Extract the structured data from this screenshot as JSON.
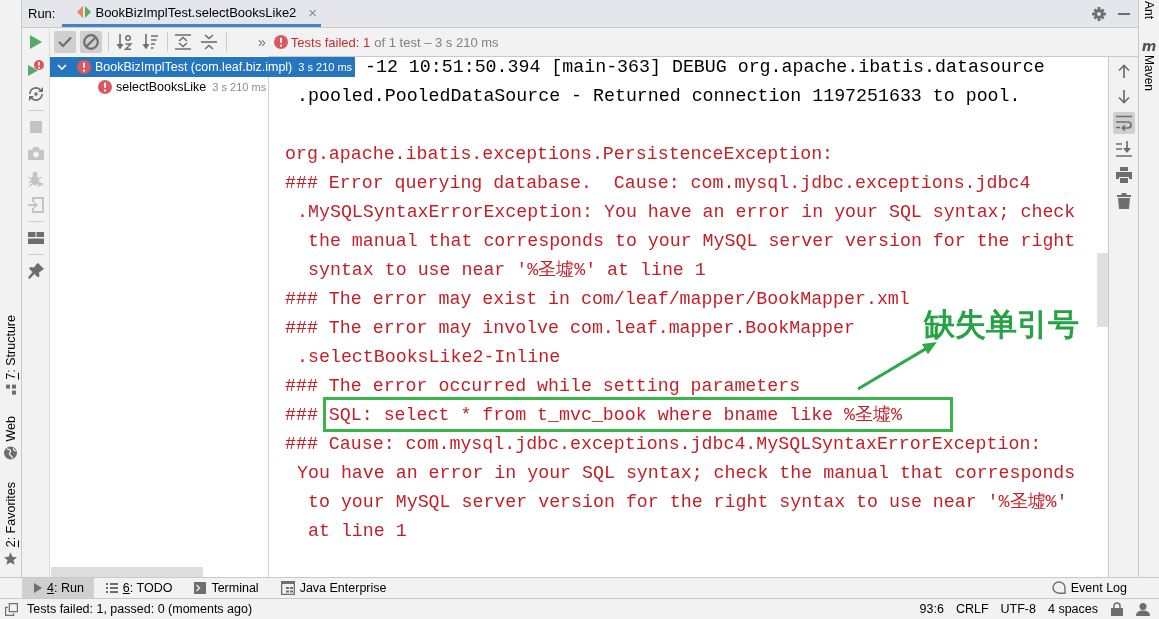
{
  "run_panel": {
    "title": "Run:",
    "tabs": [
      {
        "label": "BookBizImplTest.selectBooksLike2",
        "close": "×",
        "selected": true
      }
    ]
  },
  "run_toolbar": [
    [
      {
        "kind": "play",
        "disabled": false
      },
      {
        "kind": "play-error",
        "disabled": false
      },
      {
        "kind": "cycle",
        "disabled": false
      }
    ],
    [
      {
        "kind": "stop",
        "disabled": true
      },
      {
        "kind": "camera",
        "disabled": true
      },
      {
        "kind": "bug",
        "disabled": true
      },
      {
        "kind": "exit",
        "disabled": true
      }
    ],
    [
      {
        "kind": "layout",
        "disabled": false
      }
    ],
    [
      {
        "kind": "pin",
        "disabled": false
      }
    ]
  ],
  "test_toolbar": {
    "groups": [
      [
        {
          "kind": "check",
          "on": true
        },
        {
          "kind": "ban",
          "on": true
        }
      ],
      [
        {
          "kind": "sort-az",
          "on": false
        },
        {
          "kind": "sort-lines",
          "on": false
        }
      ],
      [
        {
          "kind": "expand",
          "on": false
        },
        {
          "kind": "collapse",
          "on": false
        }
      ]
    ],
    "more": "»",
    "summary": {
      "failed": true,
      "label": "Tests failed: 1",
      "detail": "of 1 test – 3 s 210 ms"
    }
  },
  "test_tree": [
    {
      "name": "BookBizImplTest (com.leaf.biz.impl)",
      "duration": "3 s 210 ms",
      "failed": true,
      "selected": true,
      "expanded": true,
      "children": [
        {
          "name": "selectBooksLike",
          "duration": "3 s 210 ms",
          "failed": true,
          "selected": false
        }
      ]
    }
  ],
  "console": {
    "messages": [
      {
        "kind": "debug",
        "covered": true,
        "highlighted": false,
        "lines": [
          "-12 10:51:50.394 [main-363] DEBUG org.apache.ibatis.datasource",
          ".pooled.PooledDataSource - Returned connection 1197251633 to pool."
        ]
      },
      {
        "kind": "blank"
      },
      {
        "kind": "error",
        "covered": false,
        "highlighted": false,
        "lines": [
          "org.apache.ibatis.exceptions.PersistenceException:"
        ]
      },
      {
        "kind": "error",
        "covered": false,
        "highlighted": false,
        "lines": [
          "### Error querying database.  Cause: com.mysql.jdbc.exceptions.jdbc4",
          ".MySQLSyntaxErrorException: You have an error in your SQL syntax; check",
          "the manual that corresponds to your MySQL server version for the right",
          "syntax to use near '%圣墟%' at line 1"
        ]
      },
      {
        "kind": "error",
        "covered": false,
        "highlighted": false,
        "lines": [
          "### The error may exist in com/leaf/mapper/BookMapper.xml"
        ]
      },
      {
        "kind": "error",
        "covered": false,
        "highlighted": false,
        "lines": [
          "### The error may involve com.leaf.mapper.BookMapper",
          ".selectBooksLike2-Inline"
        ]
      },
      {
        "kind": "error",
        "covered": false,
        "highlighted": false,
        "lines": [
          "### The error occurred while setting parameters"
        ]
      },
      {
        "kind": "error",
        "covered": false,
        "highlighted": true,
        "note": "缺失单引号",
        "lines": [
          "### SQL: select * from t_mvc_book where bname like %圣墟%"
        ]
      },
      {
        "kind": "error",
        "covered": false,
        "highlighted": false,
        "lines": [
          "### Cause: com.mysql.jdbc.exceptions.jdbc4.MySQLSyntaxErrorException:",
          "You have an error in your SQL syntax; check the manual that corresponds",
          "to your MySQL server version for the right syntax to use near '%圣墟%'",
          "at line 1"
        ]
      }
    ]
  },
  "console_toolbar": [
    {
      "kind": "up",
      "on": false
    },
    {
      "kind": "down",
      "on": false
    },
    {
      "kind": "wrap",
      "on": true
    },
    {
      "kind": "scroll-end",
      "on": false
    },
    {
      "kind": "print",
      "on": false
    },
    {
      "kind": "trash",
      "on": false
    }
  ],
  "left_strip": [
    {
      "kind": "structure",
      "label": "7: Structure",
      "mnemonic": true
    },
    {
      "kind": "web",
      "label": "Web",
      "mnemonic": false
    },
    {
      "kind": "favorites",
      "label": "2: Favorites",
      "mnemonic": true
    }
  ],
  "right_strip": [
    {
      "label": "Ant"
    },
    {
      "label": "Maven",
      "icon": "m"
    }
  ],
  "tool_tabs": [
    {
      "kind": "run",
      "label": "4: Run",
      "mnemonic": true,
      "selected": true
    },
    {
      "kind": "todo",
      "label": "6: TODO",
      "mnemonic": true,
      "selected": false
    },
    {
      "kind": "terminal",
      "label": "Terminal",
      "mnemonic": false,
      "selected": false
    },
    {
      "kind": "enterprise",
      "label": "Java Enterprise",
      "mnemonic": false,
      "selected": false
    }
  ],
  "tool_tabs_right": [
    {
      "kind": "event-log",
      "label": "Event Log",
      "mnemonic": false,
      "selected": false
    }
  ],
  "status_bar": {
    "message": "Tests failed: 1, passed: 0 (moments ago)",
    "fields": [
      "93:6",
      "CRLF",
      "UTF-8",
      "4 spaces"
    ]
  }
}
